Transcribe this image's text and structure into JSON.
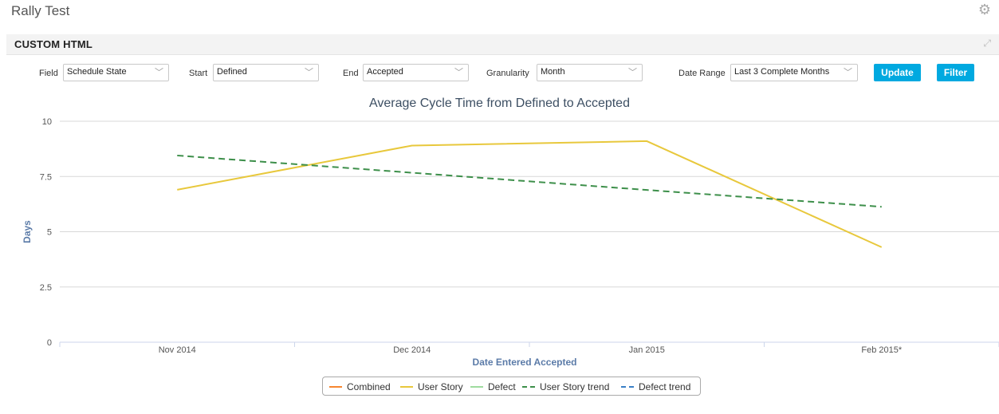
{
  "app": {
    "title": "Rally Test"
  },
  "panel": {
    "title": "CUSTOM HTML"
  },
  "controls": {
    "field": {
      "label": "Field",
      "value": "Schedule State"
    },
    "start": {
      "label": "Start",
      "value": "Defined"
    },
    "end": {
      "label": "End",
      "value": "Accepted"
    },
    "granularity": {
      "label": "Granularity",
      "value": "Month"
    },
    "date_range": {
      "label": "Date Range",
      "value": "Last 3 Complete Months"
    },
    "update_label": "Update",
    "filter_label": "Filter"
  },
  "colors": {
    "combined": "#f7862f",
    "user_story": "#e8c83c",
    "defect": "#9fdc9f",
    "user_story_trend": "#3d8f4a",
    "defect_trend": "#3a7fc6",
    "button": "#00a9e0"
  },
  "chart_data": {
    "type": "line",
    "title": "Average Cycle Time from Defined to Accepted",
    "xlabel": "Date Entered Accepted",
    "ylabel": "Days",
    "categories": [
      "Nov 2014",
      "Dec 2014",
      "Jan 2015",
      "Feb 2015*"
    ],
    "ylim": [
      0,
      10
    ],
    "yticks": [
      "0",
      "2.5",
      "5",
      "7.5",
      "10"
    ],
    "grid": true,
    "legend_position": "bottom",
    "series": [
      {
        "name": "Combined",
        "values": [],
        "style": "solid"
      },
      {
        "name": "User Story",
        "values": [
          6.9,
          8.9,
          9.1,
          4.3
        ],
        "style": "solid"
      },
      {
        "name": "Defect",
        "values": [],
        "style": "solid"
      },
      {
        "name": "User Story trend",
        "values": [
          8.45,
          7.67,
          6.89,
          6.13
        ],
        "style": "dashed"
      },
      {
        "name": "Defect trend",
        "values": [],
        "style": "dashed"
      }
    ]
  }
}
